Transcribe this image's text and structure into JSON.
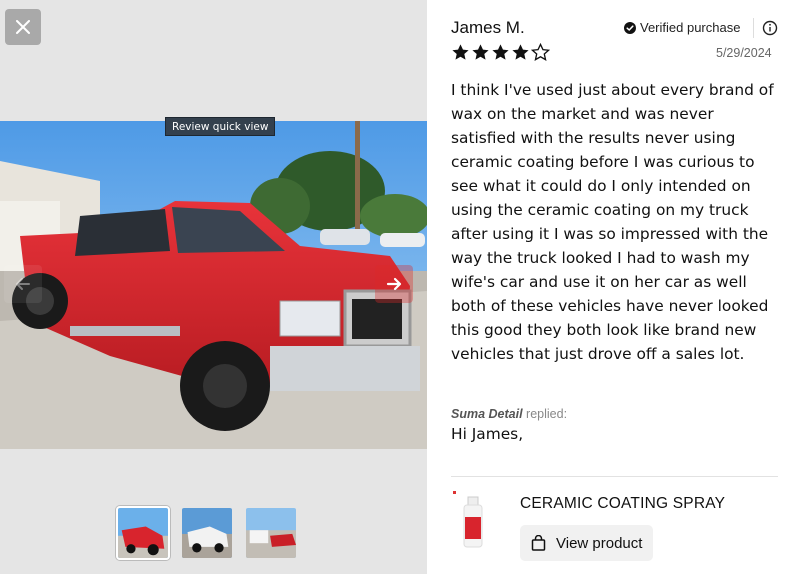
{
  "media": {
    "tooltip": "Review quick view",
    "thumbnails": [
      "thumb-1",
      "thumb-2",
      "thumb-3"
    ],
    "active_thumbnail": 0
  },
  "review": {
    "author": "James M.",
    "verified_label": "Verified purchase",
    "rating": 4,
    "max_rating": 5,
    "date": "5/29/2024",
    "body": "I think I've used just about every brand of wax on the market and was never satisfied with the results never using ceramic coating before I was curious to see what it could do I only intended on using the ceramic coating on my truck after using it I was so impressed with the way the truck looked I had to wash my wife's car and use it on her car as well both of these vehicles have never looked this good they both look like brand new vehicles that just drove off a sales lot.",
    "reply": {
      "brand": "Suma Detail",
      "replied_label": "replied:",
      "text": "Hi James,"
    }
  },
  "product": {
    "name": "CERAMIC COATING SPRAY",
    "button_label": "View product"
  },
  "colors": {
    "star": "#111111",
    "truck_red": "#d8242d",
    "sky": "#5aa3e6"
  }
}
